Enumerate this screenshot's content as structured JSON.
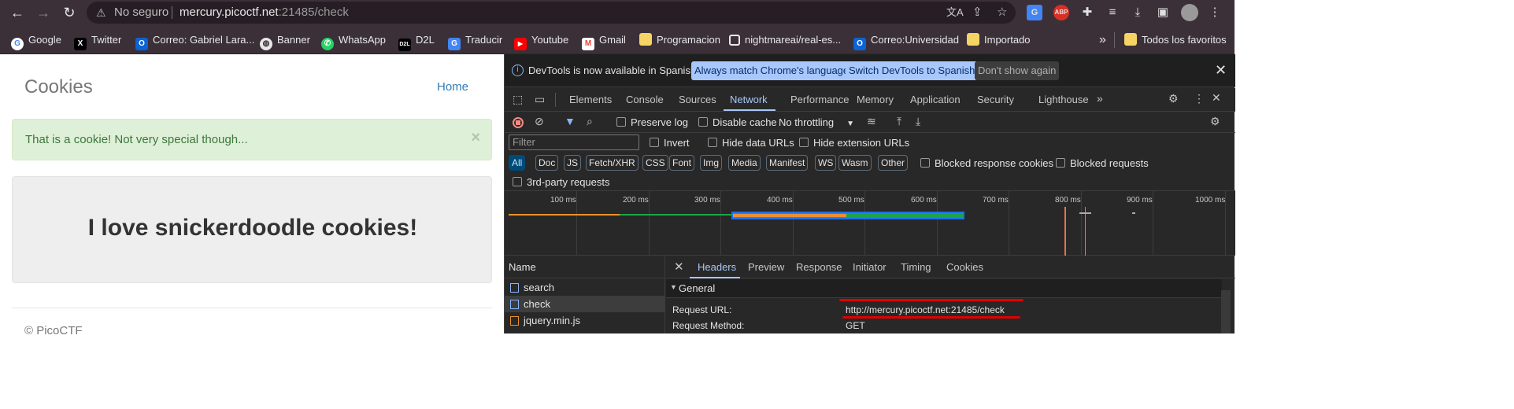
{
  "browser": {
    "security": "No seguro",
    "url_host": "mercury.picoctf.net",
    "url_port_path": ":21485/check",
    "bookmarks": [
      {
        "label": "Google",
        "icon": "google-icon",
        "color": "#4285f4"
      },
      {
        "label": "Twitter",
        "icon": "x-icon",
        "color": "#000000"
      },
      {
        "label": "Correo: Gabriel Lara...",
        "icon": "outlook-icon",
        "color": "#0a64d6"
      },
      {
        "label": "Banner",
        "icon": "globe-icon",
        "color": "#9aa0a6"
      },
      {
        "label": "WhatsApp",
        "icon": "whatsapp-icon",
        "color": "#25d366"
      },
      {
        "label": "D2L",
        "icon": "d2l-icon",
        "color": "#000000"
      },
      {
        "label": "Traducir",
        "icon": "translate-icon",
        "color": "#4285f4"
      },
      {
        "label": "Youtube",
        "icon": "youtube-icon",
        "color": "#ff0000"
      },
      {
        "label": "Gmail",
        "icon": "gmail-icon",
        "color": "#ea4335"
      },
      {
        "label": "Programacion",
        "icon": "folder-icon",
        "color": "#f6d365"
      },
      {
        "label": "nightmareai/real-es...",
        "icon": "github-icon",
        "color": "#e8e8e8"
      },
      {
        "label": "Correo:Universidad",
        "icon": "outlook-icon",
        "color": "#0a64d6"
      },
      {
        "label": "Importado",
        "icon": "folder-icon",
        "color": "#f6d365"
      }
    ],
    "bookmarks_more": "»",
    "all_bookmarks": "Todos los favoritos"
  },
  "page": {
    "title": "Cookies",
    "home": "Home",
    "alert": "That is a cookie! Not very special though...",
    "alert_close": "×",
    "heading": "I love snickerdoodle cookies!",
    "footer": "© PicoCTF"
  },
  "devtools": {
    "info_message": "DevTools is now available in Spanish!",
    "btn_match": "Always match Chrome's language",
    "btn_switch": "Switch DevTools to Spanish",
    "btn_dismiss": "Don't show again",
    "tabs": [
      "Elements",
      "Console",
      "Sources",
      "Network",
      "Performance",
      "Memory",
      "Application",
      "Security",
      "Lighthouse"
    ],
    "active_tab": "Network",
    "preserve_log": "Preserve log",
    "disable_cache": "Disable cache",
    "throttling": "No throttling",
    "filter_placeholder": "Filter",
    "invert": "Invert",
    "hide_data_urls": "Hide data URLs",
    "hide_extension_urls": "Hide extension URLs",
    "types": [
      "All",
      "Doc",
      "JS",
      "Fetch/XHR",
      "CSS",
      "Font",
      "Img",
      "Media",
      "Manifest",
      "WS",
      "Wasm",
      "Other"
    ],
    "blocked_response_cookies": "Blocked response cookies",
    "blocked_requests": "Blocked requests",
    "third_party": "3rd-party requests",
    "timeline_ticks": [
      "100 ms",
      "200 ms",
      "300 ms",
      "400 ms",
      "500 ms",
      "600 ms",
      "700 ms",
      "800 ms",
      "900 ms",
      "1000 ms"
    ],
    "name_header": "Name",
    "requests": [
      "search",
      "check",
      "jquery.min.js"
    ],
    "selected_request": "check",
    "detail_tabs": [
      "Headers",
      "Preview",
      "Response",
      "Initiator",
      "Timing",
      "Cookies"
    ],
    "general": "General",
    "request_url_label": "Request URL:",
    "request_url": "http://mercury.picoctf.net:21485/check",
    "request_method_label": "Request Method:",
    "request_method": "GET"
  }
}
